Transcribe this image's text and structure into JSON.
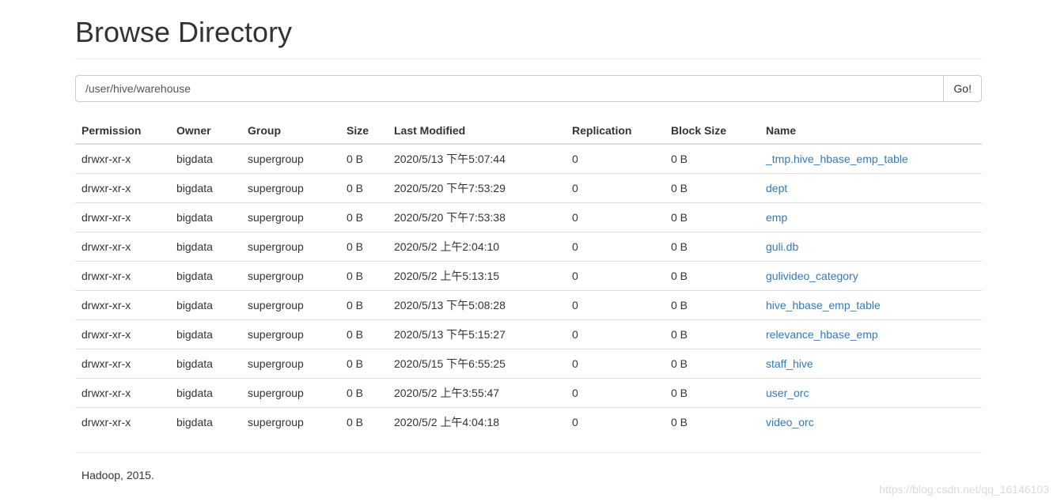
{
  "page": {
    "title": "Browse Directory",
    "path_value": "/user/hive/warehouse",
    "go_label": "Go!",
    "footer": "Hadoop, 2015.",
    "watermark": "https://blog.csdn.net/qq_16146103"
  },
  "table": {
    "headers": {
      "permission": "Permission",
      "owner": "Owner",
      "group": "Group",
      "size": "Size",
      "last_modified": "Last Modified",
      "replication": "Replication",
      "block_size": "Block Size",
      "name": "Name"
    },
    "rows": [
      {
        "permission": "drwxr-xr-x",
        "owner": "bigdata",
        "group": "supergroup",
        "size": "0 B",
        "last_modified": "2020/5/13 下午5:07:44",
        "replication": "0",
        "block_size": "0 B",
        "name": "_tmp.hive_hbase_emp_table"
      },
      {
        "permission": "drwxr-xr-x",
        "owner": "bigdata",
        "group": "supergroup",
        "size": "0 B",
        "last_modified": "2020/5/20 下午7:53:29",
        "replication": "0",
        "block_size": "0 B",
        "name": "dept"
      },
      {
        "permission": "drwxr-xr-x",
        "owner": "bigdata",
        "group": "supergroup",
        "size": "0 B",
        "last_modified": "2020/5/20 下午7:53:38",
        "replication": "0",
        "block_size": "0 B",
        "name": "emp"
      },
      {
        "permission": "drwxr-xr-x",
        "owner": "bigdata",
        "group": "supergroup",
        "size": "0 B",
        "last_modified": "2020/5/2 上午2:04:10",
        "replication": "0",
        "block_size": "0 B",
        "name": "guli.db"
      },
      {
        "permission": "drwxr-xr-x",
        "owner": "bigdata",
        "group": "supergroup",
        "size": "0 B",
        "last_modified": "2020/5/2 上午5:13:15",
        "replication": "0",
        "block_size": "0 B",
        "name": "gulivideo_category"
      },
      {
        "permission": "drwxr-xr-x",
        "owner": "bigdata",
        "group": "supergroup",
        "size": "0 B",
        "last_modified": "2020/5/13 下午5:08:28",
        "replication": "0",
        "block_size": "0 B",
        "name": "hive_hbase_emp_table"
      },
      {
        "permission": "drwxr-xr-x",
        "owner": "bigdata",
        "group": "supergroup",
        "size": "0 B",
        "last_modified": "2020/5/13 下午5:15:27",
        "replication": "0",
        "block_size": "0 B",
        "name": "relevance_hbase_emp"
      },
      {
        "permission": "drwxr-xr-x",
        "owner": "bigdata",
        "group": "supergroup",
        "size": "0 B",
        "last_modified": "2020/5/15 下午6:55:25",
        "replication": "0",
        "block_size": "0 B",
        "name": "staff_hive"
      },
      {
        "permission": "drwxr-xr-x",
        "owner": "bigdata",
        "group": "supergroup",
        "size": "0 B",
        "last_modified": "2020/5/2 上午3:55:47",
        "replication": "0",
        "block_size": "0 B",
        "name": "user_orc"
      },
      {
        "permission": "drwxr-xr-x",
        "owner": "bigdata",
        "group": "supergroup",
        "size": "0 B",
        "last_modified": "2020/5/2 上午4:04:18",
        "replication": "0",
        "block_size": "0 B",
        "name": "video_orc"
      }
    ]
  }
}
